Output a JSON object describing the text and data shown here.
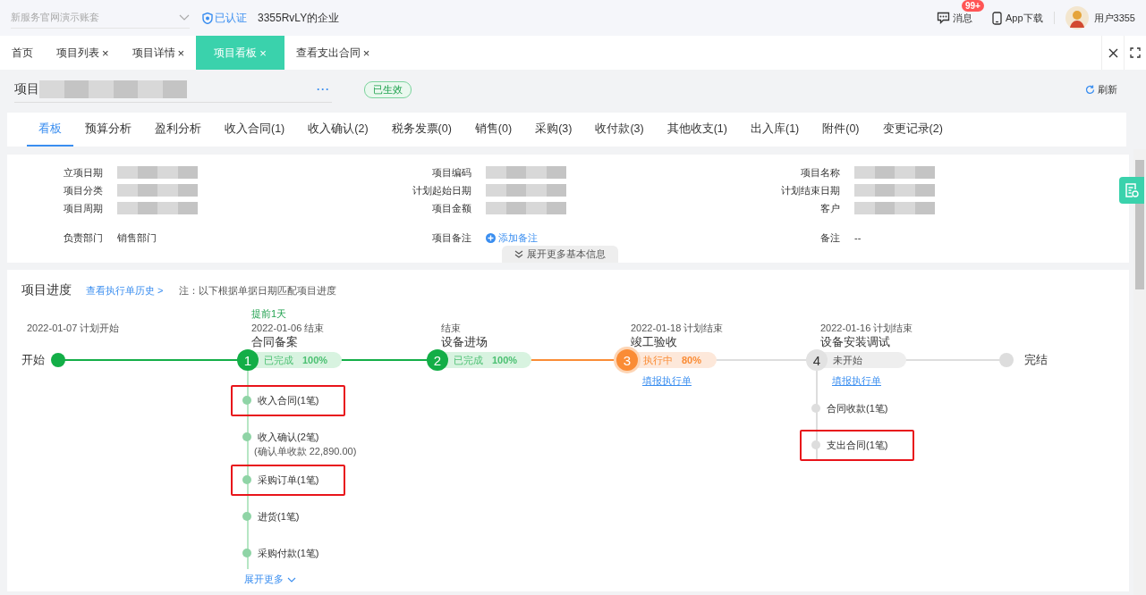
{
  "topbar": {
    "account_select": {
      "placeholder": "新服务官网演示账套"
    },
    "verified": "已认证",
    "company": "3355RvLY的企业",
    "messages": {
      "label": "消息",
      "badge": "99+"
    },
    "app_download": "App下载",
    "user": "用户3355"
  },
  "tabs": [
    {
      "label": "首页",
      "closable": false,
      "selected": false
    },
    {
      "label": "项目列表",
      "closable": true,
      "selected": false
    },
    {
      "label": "项目详情",
      "closable": true,
      "selected": false
    },
    {
      "label": "项目看板",
      "closable": true,
      "selected": true
    },
    {
      "label": "查看支出合同",
      "closable": true,
      "selected": false
    }
  ],
  "tab_close_glyph": "×",
  "project": {
    "title_prefix": "项目",
    "more": "···",
    "status": "已生效",
    "refresh": "刷新"
  },
  "subtabs": [
    {
      "label": "看板",
      "selected": true
    },
    {
      "label": "预算分析",
      "selected": false
    },
    {
      "label": "盈利分析",
      "selected": false
    },
    {
      "label": "收入合同(1)",
      "selected": false
    },
    {
      "label": "收入确认(2)",
      "selected": false
    },
    {
      "label": "税务发票(0)",
      "selected": false
    },
    {
      "label": "销售(0)",
      "selected": false
    },
    {
      "label": "采购(3)",
      "selected": false
    },
    {
      "label": "收付款(3)",
      "selected": false
    },
    {
      "label": "其他收支(1)",
      "selected": false
    },
    {
      "label": "出入库(1)",
      "selected": false
    },
    {
      "label": "附件(0)",
      "selected": false
    },
    {
      "label": "变更记录(2)",
      "selected": false
    }
  ],
  "info_fields": [
    {
      "label": "立项日期",
      "kind": "redacted"
    },
    {
      "label": "项目编码",
      "kind": "redacted"
    },
    {
      "label": "项目名称",
      "kind": "redacted"
    },
    {
      "label": "项目分类",
      "kind": "redacted"
    },
    {
      "label": "计划起始日期",
      "kind": "redacted"
    },
    {
      "label": "计划结束日期",
      "kind": "redacted"
    },
    {
      "label": "项目周期",
      "kind": "redacted"
    },
    {
      "label": "项目金额",
      "kind": "redacted"
    },
    {
      "label": "客户",
      "kind": "redacted"
    },
    {
      "label": "负责部门",
      "kind": "text",
      "value": "销售部门"
    },
    {
      "label": "项目备注",
      "kind": "link",
      "value": "添加备注"
    },
    {
      "label": "备注",
      "kind": "text",
      "value": "--"
    }
  ],
  "expand_info": "展开更多基本信息",
  "progress": {
    "title": "项目进度",
    "history_link": "查看执行单历史 >",
    "note": "注：以下根据单据日期匹配项目进度",
    "start": {
      "label": "开始",
      "date": "2022-01-07 计划开始"
    },
    "stages": [
      {
        "number": "1",
        "kind": "done",
        "ahead_note": "提前1天",
        "date": "2022-01-06 结束",
        "name": "合同备案",
        "state_label": "已完成",
        "percent": "100%",
        "items": [
          {
            "text": "收入合同(1笔)",
            "highlighted": true
          },
          {
            "text": "收入确认(2笔)",
            "note": "(确认单收款 22,890.00)",
            "highlighted": false
          },
          {
            "text": "采购订单(1笔)",
            "highlighted": true
          },
          {
            "text": "进货(1笔)",
            "highlighted": false
          },
          {
            "text": "采购付款(1笔)",
            "highlighted": false
          }
        ],
        "expand": "展开更多"
      },
      {
        "number": "2",
        "kind": "done",
        "date": "结束",
        "name": "设备进场",
        "state_label": "已完成",
        "percent": "100%"
      },
      {
        "number": "3",
        "kind": "active",
        "date": "2022-01-18 计划结束",
        "name": "竣工验收",
        "state_label": "执行中",
        "percent": "80%",
        "link": "填报执行单"
      },
      {
        "number": "4",
        "kind": "pending",
        "date": "2022-01-16 计划结束",
        "name": "设备安装调试",
        "state_label": "未开始",
        "link": "填报执行单",
        "items": [
          {
            "text": "合同收款(1笔)",
            "highlighted": false
          },
          {
            "text": "支出合同(1笔)",
            "highlighted": true
          }
        ]
      }
    ],
    "end": {
      "label": "完结"
    }
  }
}
